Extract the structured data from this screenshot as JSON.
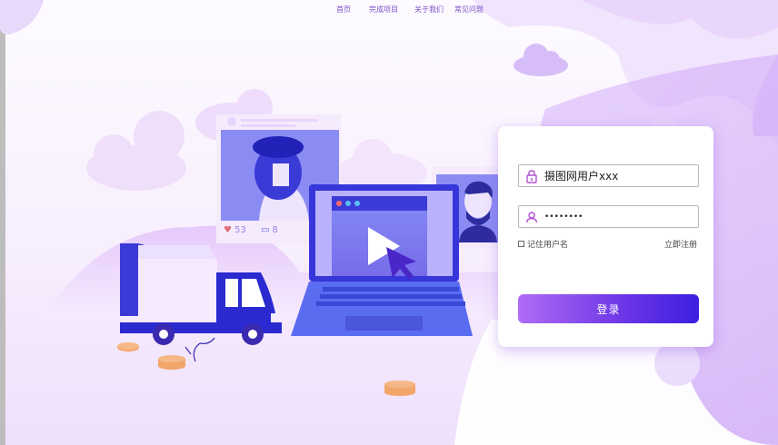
{
  "nav": {
    "items": [
      {
        "label": "首页"
      },
      {
        "label": "完成项目"
      },
      {
        "label": "关于我们"
      },
      {
        "label": "常见问题"
      }
    ]
  },
  "social_card": {
    "likes": "53",
    "comments": "8"
  },
  "login": {
    "username_value": "摄图网用户xxx",
    "password_value": "********",
    "remember_label": "记住用户名",
    "register_label": "立即注册",
    "submit_label": "登录"
  },
  "colors": {
    "accent": "#7a4fc9",
    "button_start": "#b06cf5",
    "button_end": "#3d1ee0"
  },
  "icons": {
    "username": "lock-icon",
    "password": "user-icon"
  }
}
